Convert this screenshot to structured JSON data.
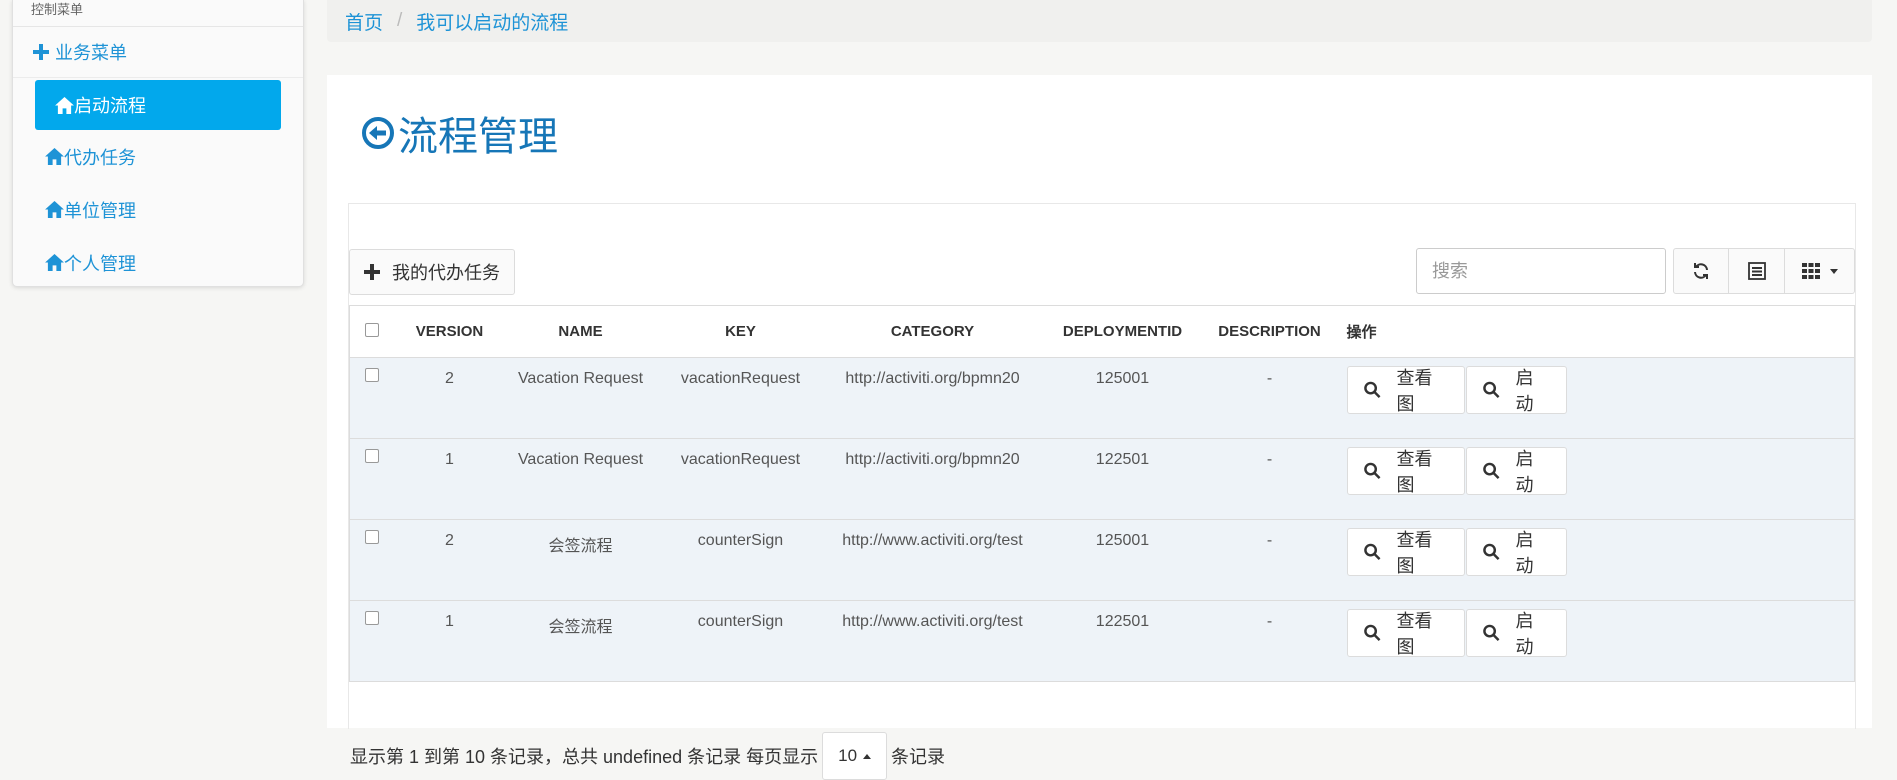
{
  "sidebar": {
    "header": "控制菜单",
    "group_label": "业务菜单",
    "items": [
      {
        "label": "启动流程",
        "active": true
      },
      {
        "label": "代办任务",
        "active": false
      },
      {
        "label": "单位管理",
        "active": false
      },
      {
        "label": "个人管理",
        "active": false
      }
    ]
  },
  "breadcrumb": {
    "home": "首页",
    "separator": "/",
    "current": "我可以启动的流程"
  },
  "page": {
    "title": "流程管理"
  },
  "toolbar": {
    "todo_button": "我的代办任务",
    "search_placeholder": "搜索"
  },
  "table": {
    "columns": [
      "VERSION",
      "NAME",
      "KEY",
      "CATEGORY",
      "DEPLOYMENTID",
      "DESCRIPTION",
      "操作"
    ],
    "rows": [
      {
        "version": "2",
        "name": "Vacation Request",
        "key": "vacationRequest",
        "category": "http://activiti.org/bpmn20",
        "deploymentid": "125001",
        "description": "-"
      },
      {
        "version": "1",
        "name": "Vacation Request",
        "key": "vacationRequest",
        "category": "http://activiti.org/bpmn20",
        "deploymentid": "122501",
        "description": "-"
      },
      {
        "version": "2",
        "name": "会签流程",
        "key": "counterSign",
        "category": "http://www.activiti.org/test",
        "deploymentid": "125001",
        "description": "-"
      },
      {
        "version": "1",
        "name": "会签流程",
        "key": "counterSign",
        "category": "http://www.activiti.org/test",
        "deploymentid": "122501",
        "description": "-"
      }
    ],
    "view_label": "查看图",
    "start_label": "启动"
  },
  "pagination": {
    "info_prefix": "显示第 1 到第 10 条记录，总共 undefined 条记录 每页显示",
    "page_size": "10",
    "info_suffix": "条记录"
  },
  "colors": {
    "accent": "#1e93d6",
    "active_bg": "#02a8ec",
    "title": "#1676b7",
    "row_bg": "#eef3f8"
  }
}
